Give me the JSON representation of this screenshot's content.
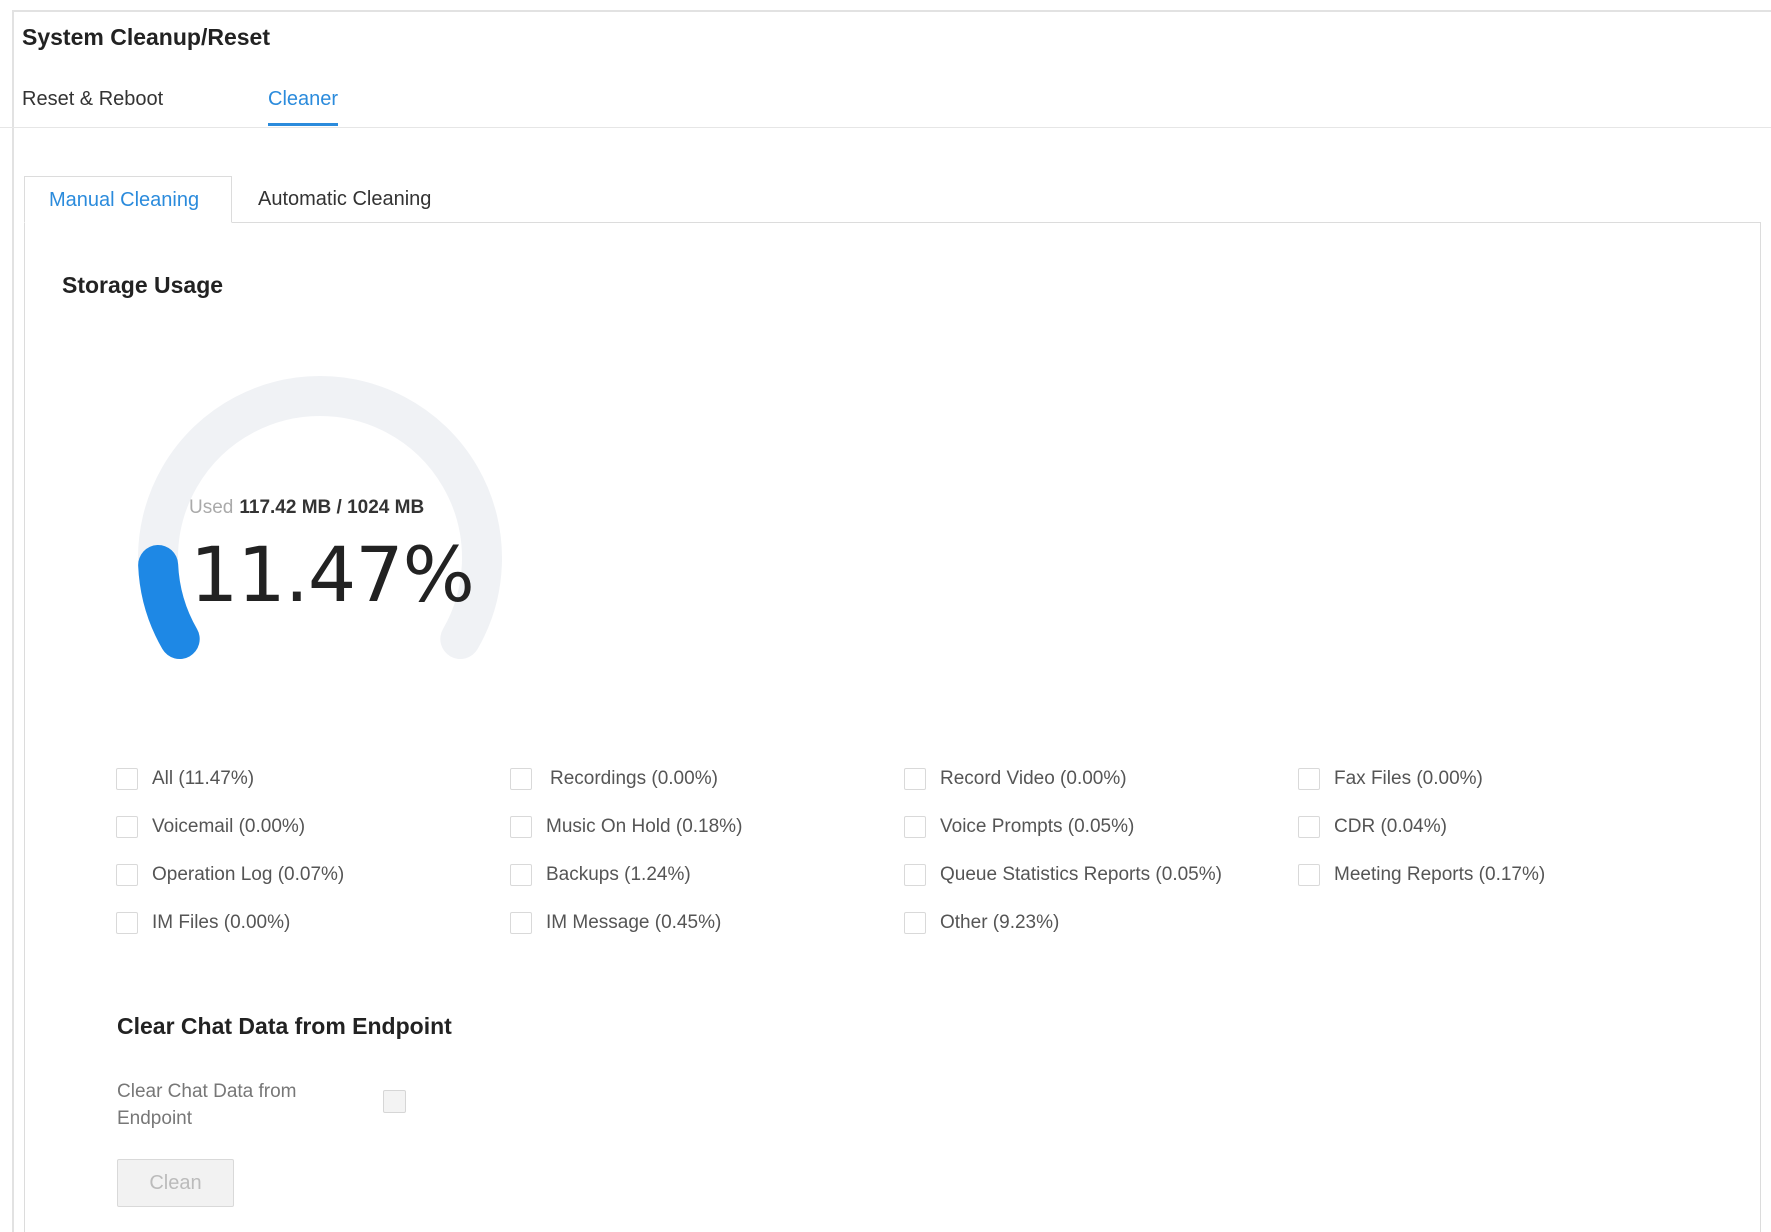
{
  "page": {
    "title": "System Cleanup/Reset"
  },
  "top_tabs": [
    {
      "label": "Reset & Reboot",
      "active": false
    },
    {
      "label": "Cleaner",
      "active": true
    }
  ],
  "sub_tabs": [
    {
      "label": "Manual Cleaning",
      "active": true
    },
    {
      "label": "Automatic Cleaning",
      "active": false
    }
  ],
  "storage": {
    "title": "Storage Usage",
    "used_label": "Used",
    "used_value": "117.42 MB / 1024 MB",
    "percent_text": "11.47%",
    "percent_fraction": 0.1147,
    "colors": {
      "fill": "#1e88e5",
      "track": "#f0f2f5"
    }
  },
  "cleanup_options": [
    {
      "label": "All (11.47%)",
      "checked": false
    },
    {
      "label": "Recordings (0.00%)",
      "checked": false
    },
    {
      "label": "Record Video (0.00%)",
      "checked": false
    },
    {
      "label": "Fax Files (0.00%)",
      "checked": false
    },
    {
      "label": "Voicemail (0.00%)",
      "checked": false
    },
    {
      "label": "Music On Hold (0.18%)",
      "checked": false
    },
    {
      "label": "Voice Prompts (0.05%)",
      "checked": false
    },
    {
      "label": "CDR (0.04%)",
      "checked": false
    },
    {
      "label": "Operation Log (0.07%)",
      "checked": false
    },
    {
      "label": "Backups (1.24%)",
      "checked": false
    },
    {
      "label": "Queue Statistics Reports (0.05%)",
      "checked": false
    },
    {
      "label": "Meeting Reports (0.17%)",
      "checked": false
    },
    {
      "label": "IM Files (0.00%)",
      "checked": false
    },
    {
      "label": "IM Message (0.45%)",
      "checked": false
    },
    {
      "label": "Other (9.23%)",
      "checked": false
    }
  ],
  "chat": {
    "section_title": "Clear Chat Data from Endpoint",
    "field_label": "Clear Chat Data from Endpoint",
    "checked": false
  },
  "clean_button": {
    "label": "Clean",
    "disabled": true
  },
  "accent_color": "#2b8bdc"
}
